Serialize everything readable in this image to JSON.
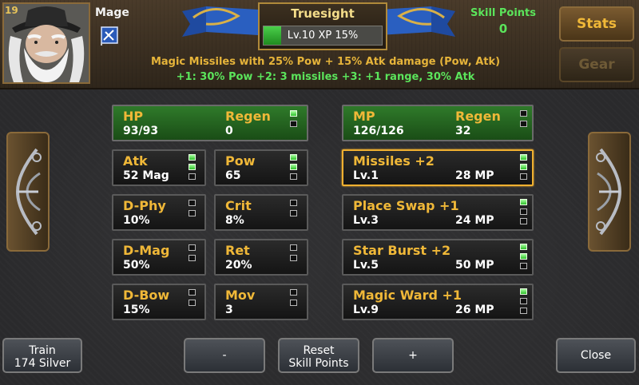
{
  "header": {
    "level_badge": "19",
    "character_name": "Mage",
    "skill_title": "Truesight",
    "xp_text": "Lv.10  XP 15%",
    "xp_progress": 0.15,
    "skill_points_label": "Skill Points",
    "skill_points_value": "0",
    "stats_tab": "Stats",
    "gear_tab": "Gear",
    "description": "Magic Missiles with 25% Pow + 15% Atk damage (Pow, Atk)",
    "upgrades": "+1: 30% Pow     +2: 3 missiles     +3: +1 range, 30% Atk"
  },
  "stats": {
    "hp": {
      "label": "HP",
      "value": "93/93",
      "regen_label": "Regen",
      "regen_value": "0",
      "pips": [
        true,
        false
      ]
    },
    "mp": {
      "label": "MP",
      "value": "126/126",
      "regen_label": "Regen",
      "regen_value": "32",
      "pips": [
        false,
        false
      ]
    },
    "atk": {
      "label": "Atk",
      "value": "52 Mag",
      "pips": [
        true,
        true,
        false
      ]
    },
    "pow": {
      "label": "Pow",
      "value": "65",
      "pips": [
        true,
        true,
        false
      ]
    },
    "dphy": {
      "label": "D-Phy",
      "value": "10%",
      "pips": [
        false,
        false
      ]
    },
    "crit": {
      "label": "Crit",
      "value": "8%",
      "pips": [
        false,
        false
      ]
    },
    "dmag": {
      "label": "D-Mag",
      "value": "50%",
      "pips": [
        false,
        false
      ]
    },
    "ret": {
      "label": "Ret",
      "value": "20%",
      "pips": [
        false,
        false
      ]
    },
    "dbow": {
      "label": "D-Bow",
      "value": "15%",
      "pips": [
        false,
        false
      ]
    },
    "mov": {
      "label": "Mov",
      "value": "3",
      "pips": [
        false,
        false
      ]
    }
  },
  "skills": [
    {
      "name": "Missiles +2",
      "level": "Lv.1",
      "cost": "28 MP",
      "pips": [
        true,
        true,
        false
      ],
      "selected": true
    },
    {
      "name": "Place Swap +1",
      "level": "Lv.3",
      "cost": "24 MP",
      "pips": [
        true,
        false,
        false
      ],
      "selected": false
    },
    {
      "name": "Star Burst +2",
      "level": "Lv.5",
      "cost": "50 MP",
      "pips": [
        true,
        true,
        false
      ],
      "selected": false
    },
    {
      "name": "Magic Ward +1",
      "level": "Lv.9",
      "cost": "26 MP",
      "pips": [
        true,
        false,
        false
      ],
      "selected": false
    }
  ],
  "buttons": {
    "train_line1": "Train",
    "train_line2": "174 Silver",
    "minus": "-",
    "reset_line1": "Reset",
    "reset_line2": "Skill Points",
    "plus": "+",
    "close": "Close"
  },
  "colors": {
    "gold_text": "#f0b838",
    "green_text": "#5be45b",
    "selected_border": "#f0b030",
    "pip_on": "#2ec02a"
  },
  "icons": {
    "class_icon": "mage-banner-icon",
    "left_arrow": "ornate-left-arrow-icon",
    "right_arrow": "ornate-right-arrow-icon"
  }
}
